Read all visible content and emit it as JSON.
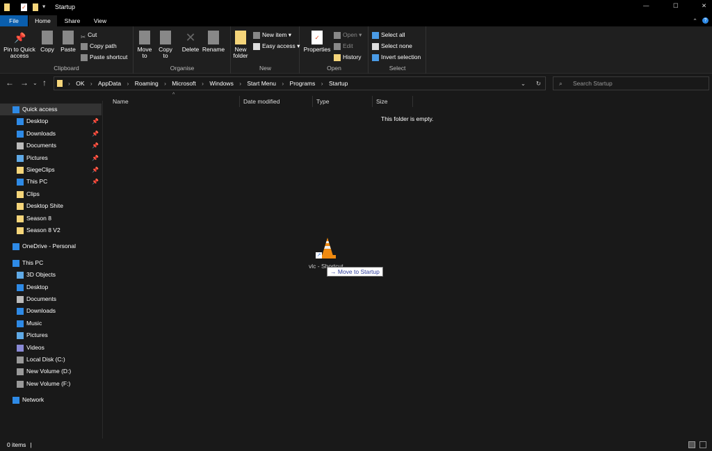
{
  "window": {
    "title": "Startup",
    "controls": [
      "—",
      "☐",
      "✕"
    ]
  },
  "tabs": [
    "File",
    "Home",
    "Share",
    "View"
  ],
  "ribbon": {
    "clipboard": {
      "label": "Clipboard",
      "pin": "Pin to Quick access",
      "copy": "Copy",
      "paste": "Paste",
      "cut": "Cut",
      "copy_path": "Copy path",
      "paste_shortcut": "Paste shortcut"
    },
    "organise": {
      "label": "Organise",
      "move_to": "Move to",
      "copy_to": "Copy to",
      "delete": "Delete",
      "rename": "Rename"
    },
    "new": {
      "label": "New",
      "new_folder": "New folder",
      "new_item": "New item",
      "easy_access": "Easy access"
    },
    "open": {
      "label": "Open",
      "properties": "Properties",
      "open": "Open",
      "edit": "Edit",
      "history": "History"
    },
    "select": {
      "label": "Select",
      "select_all": "Select all",
      "select_none": "Select none",
      "invert": "Invert selection"
    }
  },
  "breadcrumb": [
    "OK",
    "AppData",
    "Roaming",
    "Microsoft",
    "Windows",
    "Start Menu",
    "Programs",
    "Startup"
  ],
  "search_placeholder": "Search Startup",
  "sidebar": [
    {
      "label": "Quick access",
      "icon": "star",
      "color": "#2e8ae6",
      "pinned": false,
      "indent": 0
    },
    {
      "label": "Desktop",
      "icon": "desktop",
      "color": "#2e8ae6",
      "pinned": true,
      "indent": 1
    },
    {
      "label": "Downloads",
      "icon": "download",
      "color": "#2e8ae6",
      "pinned": true,
      "indent": 1
    },
    {
      "label": "Documents",
      "icon": "document",
      "color": "#bbbbbb",
      "pinned": true,
      "indent": 1
    },
    {
      "label": "Pictures",
      "icon": "picture",
      "color": "#5fa9e6",
      "pinned": true,
      "indent": 1
    },
    {
      "label": "SiegeClips",
      "icon": "folder",
      "color": "#f5d57a",
      "pinned": true,
      "indent": 1
    },
    {
      "label": "This PC",
      "icon": "pc",
      "color": "#2e8ae6",
      "pinned": true,
      "indent": 1
    },
    {
      "label": "Clips",
      "icon": "folder",
      "color": "#f5d57a",
      "pinned": false,
      "indent": 1
    },
    {
      "label": "Desktop Shite",
      "icon": "folder",
      "color": "#f5d57a",
      "pinned": false,
      "indent": 1
    },
    {
      "label": "Season 8",
      "icon": "folder",
      "color": "#f5d57a",
      "pinned": false,
      "indent": 1
    },
    {
      "label": "Season 8 V2",
      "icon": "folder",
      "color": "#f5d57a",
      "pinned": false,
      "indent": 1
    },
    {
      "label": "OneDrive - Personal",
      "icon": "cloud",
      "color": "#2e8ae6",
      "pinned": false,
      "indent": 0,
      "gap": true
    },
    {
      "label": "This PC",
      "icon": "pc",
      "color": "#2e8ae6",
      "pinned": false,
      "indent": 0,
      "gap": true
    },
    {
      "label": "3D Objects",
      "icon": "cube",
      "color": "#5fa9e6",
      "pinned": false,
      "indent": 1
    },
    {
      "label": "Desktop",
      "icon": "desktop",
      "color": "#2e8ae6",
      "pinned": false,
      "indent": 1
    },
    {
      "label": "Documents",
      "icon": "document",
      "color": "#bbbbbb",
      "pinned": false,
      "indent": 1
    },
    {
      "label": "Downloads",
      "icon": "download",
      "color": "#2e8ae6",
      "pinned": false,
      "indent": 1
    },
    {
      "label": "Music",
      "icon": "music",
      "color": "#2e8ae6",
      "pinned": false,
      "indent": 1
    },
    {
      "label": "Pictures",
      "icon": "picture",
      "color": "#5fa9e6",
      "pinned": false,
      "indent": 1
    },
    {
      "label": "Videos",
      "icon": "video",
      "color": "#8a8ad6",
      "pinned": false,
      "indent": 1
    },
    {
      "label": "Local Disk (C:)",
      "icon": "drive",
      "color": "#999999",
      "pinned": false,
      "indent": 1
    },
    {
      "label": "New Volume (D:)",
      "icon": "drive",
      "color": "#999999",
      "pinned": false,
      "indent": 1
    },
    {
      "label": "New Volume (F:)",
      "icon": "drive",
      "color": "#999999",
      "pinned": false,
      "indent": 1
    },
    {
      "label": "Network",
      "icon": "network",
      "color": "#2e8ae6",
      "pinned": false,
      "indent": 0,
      "gap": true
    }
  ],
  "columns": [
    "Name",
    "Date modified",
    "Type",
    "Size"
  ],
  "empty_message": "This folder is empty.",
  "drag_item": {
    "label": "vlc - Shortcut",
    "tooltip": "Move to Startup"
  },
  "status": {
    "items": "0 items"
  }
}
